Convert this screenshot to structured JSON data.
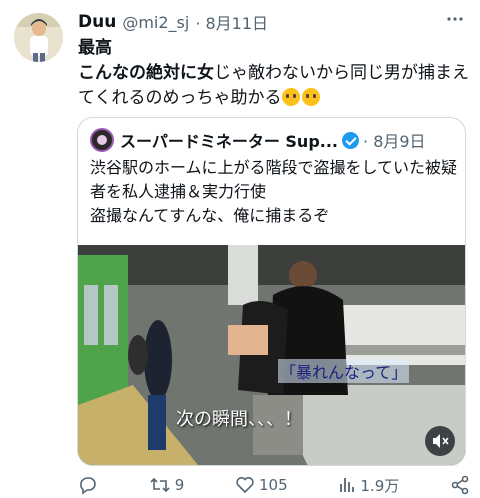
{
  "tweet": {
    "display_name": "Duu",
    "handle": "@mi2_sj",
    "date": "· 8月11日",
    "more_icon": "more-horizontal-icon",
    "text_bold": "最高\nこんなの絶対に女",
    "text_normal": "じゃ敵わないから同じ男が捕まえてくれるのめっちゃ助かる",
    "emoji": "pleading-face-emoji"
  },
  "quoted": {
    "display_name": "スーパードミネーター Sup...",
    "verified_icon": "verified-badge-icon",
    "date": "· 8月9日",
    "text": "渋谷駅のホームに上がる階段で盗撮をしていた被疑者を私人逮捕＆実力行使\n盗撮なんてすんな、俺に捕まるぞ",
    "video": {
      "caption_top": "「暴れんなって」",
      "caption_bottom": "次の瞬間、、、！"
    }
  },
  "actions": {
    "retweets": "9",
    "likes": "105",
    "views": "1.9万"
  },
  "colors": {
    "text": "#0f1419",
    "secondary": "#536471",
    "verified": "#1d9bf0",
    "border": "#cfd9de"
  }
}
